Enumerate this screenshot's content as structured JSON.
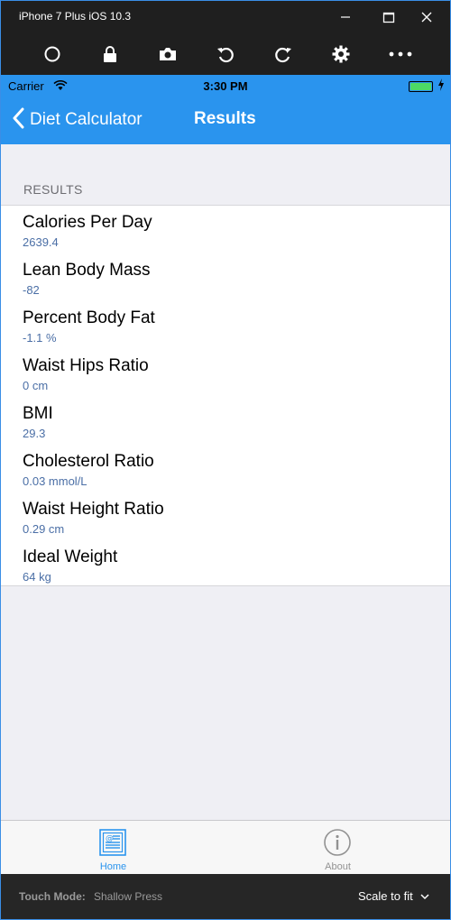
{
  "window": {
    "title": "iPhone 7 Plus iOS 10.3",
    "controls": [
      {
        "name": "minimize-icon"
      },
      {
        "name": "maximize-icon"
      },
      {
        "name": "close-icon"
      }
    ]
  },
  "toolbar": {
    "icons": [
      "home-button-icon",
      "lock-icon",
      "screenshot-camera-icon",
      "rotate-left-icon",
      "rotate-right-icon",
      "settings-gear-icon",
      "more-icon"
    ]
  },
  "status_bar": {
    "carrier": "Carrier",
    "time": "3:30 PM",
    "battery_level": 1.0,
    "battery_color": "#4cd964"
  },
  "nav_bar": {
    "back_label": "Diet Calculator",
    "title": "Results",
    "color": "#2a94ee"
  },
  "results": {
    "section_header": "RESULTS",
    "rows": [
      {
        "title": "Calories Per Day",
        "value": "2639.4"
      },
      {
        "title": "Lean Body Mass",
        "value": "-82"
      },
      {
        "title": "Percent Body Fat",
        "value": "-1.1 %"
      },
      {
        "title": "Waist Hips Ratio",
        "value": "0 cm"
      },
      {
        "title": "BMI",
        "value": "29.3"
      },
      {
        "title": "Cholesterol Ratio",
        "value": "0.03 mmol/L"
      },
      {
        "title": "Waist Height Ratio",
        "value": "0.29 cm"
      },
      {
        "title": "Ideal Weight",
        "value": "64 kg"
      }
    ]
  },
  "tab_bar": {
    "tabs": [
      {
        "label": "Home",
        "icon": "home-document-icon",
        "selected": true
      },
      {
        "label": "About",
        "icon": "info-icon",
        "selected": false
      }
    ]
  },
  "footer": {
    "touch_mode_label": "Touch Mode:",
    "touch_mode_value": "Shallow Press",
    "scale_label": "Scale to fit"
  }
}
